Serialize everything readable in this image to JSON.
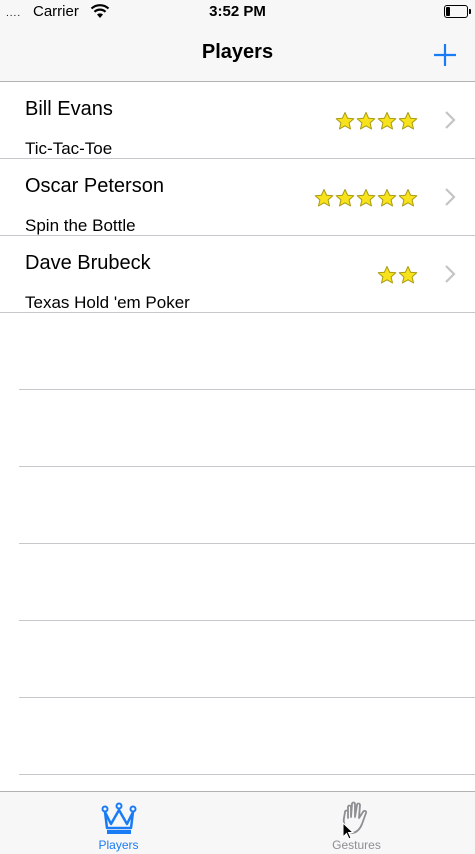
{
  "status_bar": {
    "signal": "....",
    "carrier": "Carrier",
    "time": "3:52 PM"
  },
  "nav": {
    "title": "Players",
    "add_icon": "plus-icon"
  },
  "players": [
    {
      "name": "Bill Evans",
      "game": "Tic-Tac-Toe",
      "rating": 4
    },
    {
      "name": "Oscar Peterson",
      "game": "Spin the Bottle",
      "rating": 5
    },
    {
      "name": "Dave Brubeck",
      "game": "Texas Hold 'em Poker",
      "rating": 2
    }
  ],
  "tab_bar": {
    "tabs": [
      {
        "label": "Players",
        "icon": "crown-icon",
        "selected": true
      },
      {
        "label": "Gestures",
        "icon": "hand-icon",
        "selected": false
      }
    ]
  },
  "colors": {
    "accent": "#1a7cf5",
    "star_fill": "#f7e21b",
    "star_stroke": "#a89a12"
  }
}
